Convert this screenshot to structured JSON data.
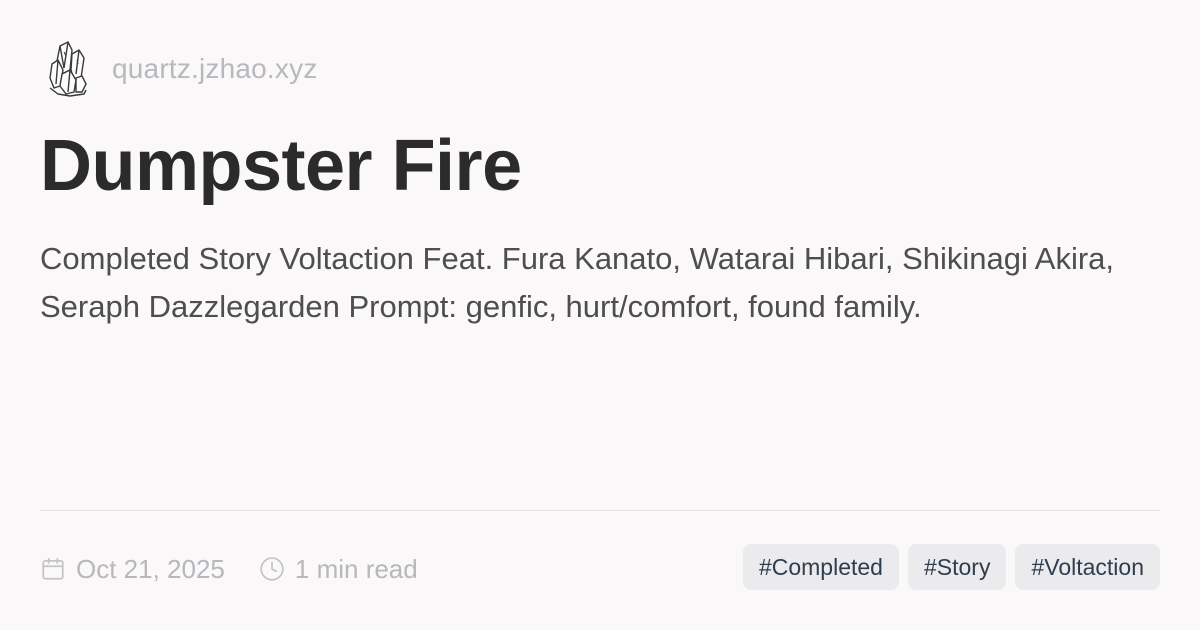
{
  "site": {
    "name": "quartz.jzhao.xyz",
    "logo_icon": "crystal-icon"
  },
  "page": {
    "title": "Dumpster Fire",
    "description": "Completed Story Voltaction Feat. Fura Kanato, Watarai Hibari, Shikinagi Akira, Seraph Dazzlegarden Prompt: genfic, hurt/comfort, found family."
  },
  "meta": {
    "date": "Oct 21, 2025",
    "date_icon": "calendar-icon",
    "read_time": "1 min read",
    "read_time_icon": "clock-icon"
  },
  "tags": [
    {
      "label": "#Completed"
    },
    {
      "label": "#Story"
    },
    {
      "label": "#Voltaction"
    }
  ],
  "colors": {
    "background": "#faf8f8",
    "title": "#2b2b2b",
    "description": "#4e4e4e",
    "muted": "#b7b7bc",
    "tag_background": "#ebebed",
    "tag_text": "#2f3d4f"
  }
}
